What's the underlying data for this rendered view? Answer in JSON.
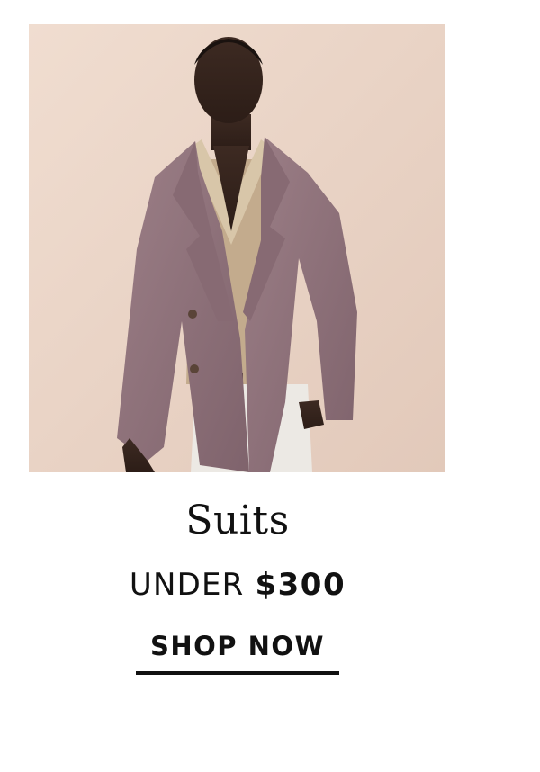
{
  "hero": {
    "alt_subject": "model-in-suit-jacket"
  },
  "promo": {
    "title": "Suits",
    "subtitle_prefix": "UNDER ",
    "subtitle_price": "$300",
    "cta_label": "SHOP NOW"
  },
  "colors": {
    "background": "#ffffff",
    "text": "#111111",
    "hero_backdrop": "#e9d5c7",
    "jacket": "#8f717a",
    "sweater": "#c3ab8d",
    "pants": "#ece9e4"
  }
}
